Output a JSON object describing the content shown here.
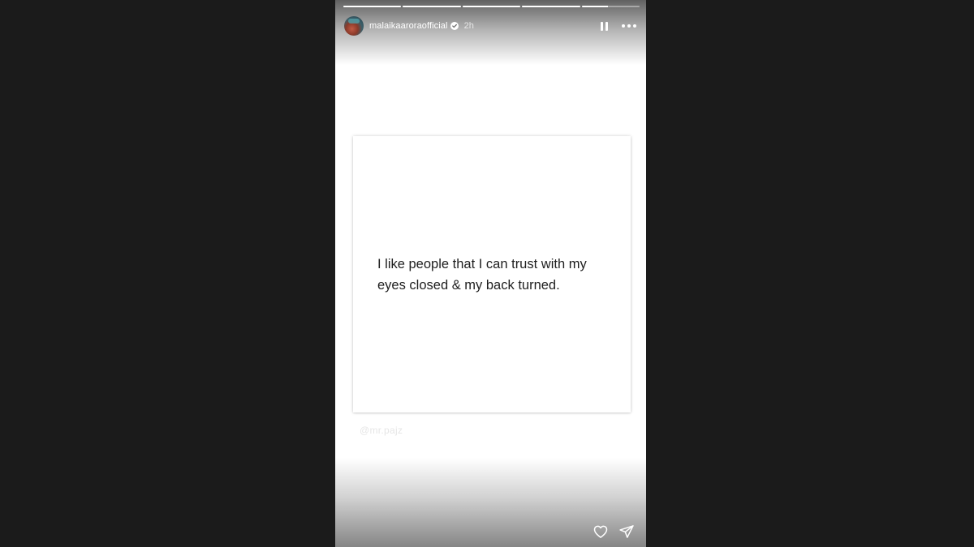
{
  "story": {
    "progress": [
      1,
      1,
      1,
      1,
      0.45
    ],
    "header": {
      "username": "malaikaaroraofficial",
      "time": "2h",
      "avatar": "avatar-photo",
      "verified_icon": "verified-badge-icon",
      "pause_icon": "pause-icon",
      "more_icon": "more-options-icon"
    },
    "quote": {
      "text": "I like people that I can trust with my eyes closed & my back turned."
    },
    "watermark": "@mr.pajz",
    "footer": {
      "like_icon": "heart-icon",
      "share_icon": "send-icon"
    }
  }
}
